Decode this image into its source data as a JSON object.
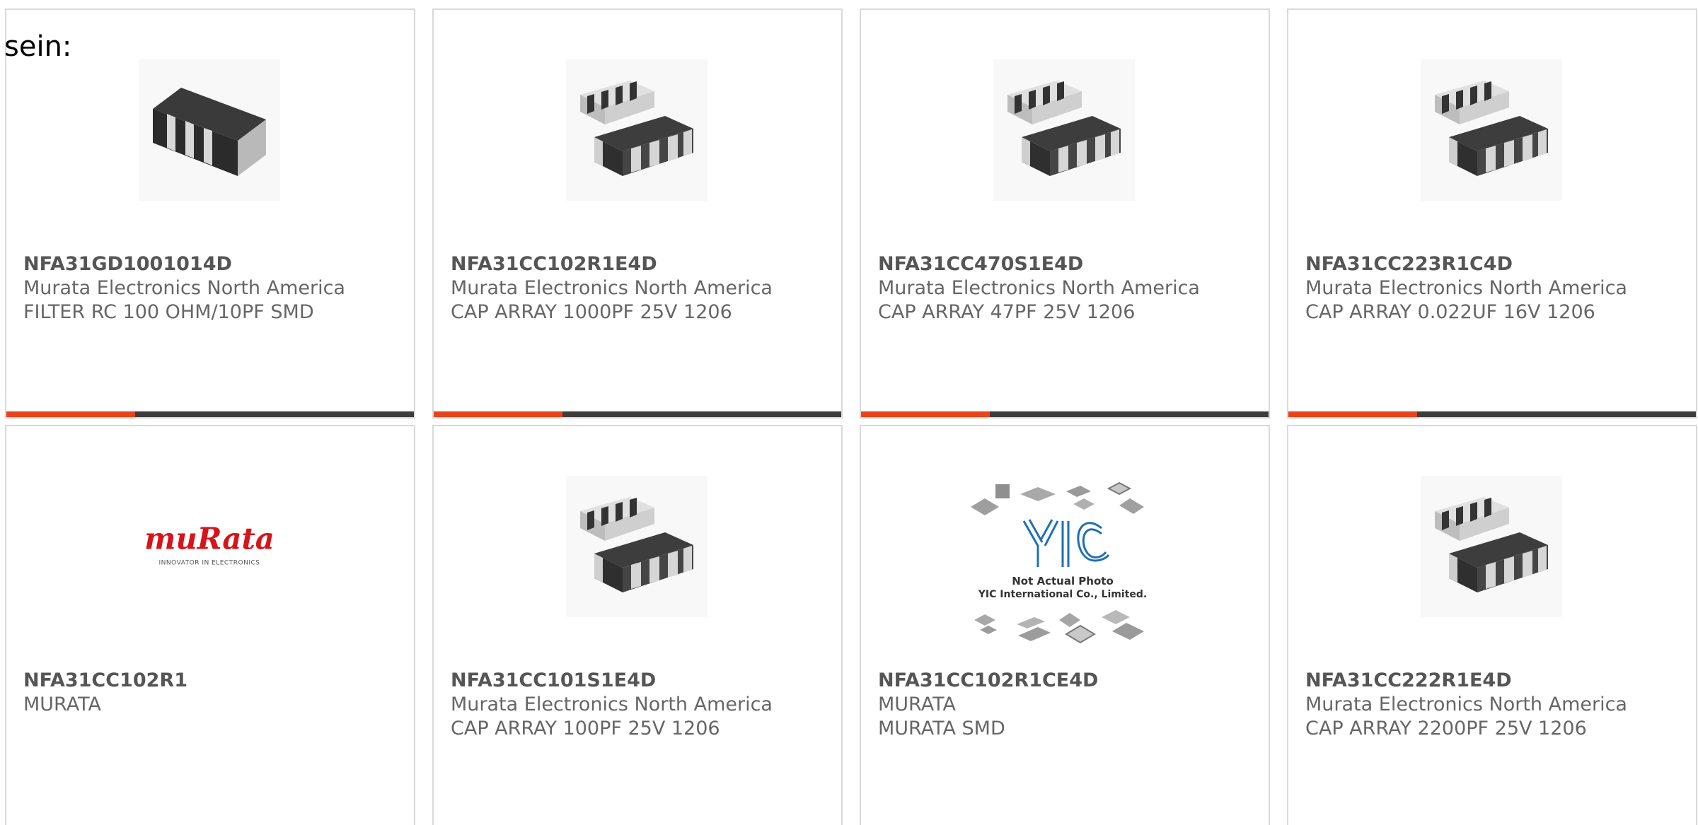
{
  "intro_text": "sein:",
  "colors": {
    "accent": "#e8431a",
    "bar": "#3d3d3d",
    "card_border": "#d9d9d9",
    "text": "#666666",
    "part_number": "#555555"
  },
  "products": [
    {
      "part_number": "NFA31GD1001014D",
      "manufacturer": "Murata Electronics North America",
      "description": "FILTER RC 100 OHM/10PF SMD",
      "image": "single-chip-component-photo"
    },
    {
      "part_number": "NFA31CC102R1E4D",
      "manufacturer": "Murata Electronics North America",
      "description": "CAP ARRAY 1000PF 25V 1206",
      "image": "capacitor-array-photo"
    },
    {
      "part_number": "NFA31CC470S1E4D",
      "manufacturer": "Murata Electronics North America",
      "description": "CAP ARRAY 47PF 25V 1206",
      "image": "capacitor-array-photo"
    },
    {
      "part_number": "NFA31CC223R1C4D",
      "manufacturer": "Murata Electronics North America",
      "description": "CAP ARRAY 0.022UF 16V 1206",
      "image": "capacitor-array-photo"
    },
    {
      "part_number": "NFA31CC102R1",
      "manufacturer": "MURATA",
      "description": "",
      "image": "murata-logo",
      "logo_text": "muRata",
      "logo_tagline": "INNOVATOR IN ELECTRONICS"
    },
    {
      "part_number": "NFA31CC101S1E4D",
      "manufacturer": "Murata Electronics North America",
      "description": "CAP ARRAY 100PF 25V 1206",
      "image": "capacitor-array-photo"
    },
    {
      "part_number": "NFA31CC102R1CE4D",
      "manufacturer": "MURATA",
      "description": "MURATA SMD",
      "image": "yic-placeholder",
      "logo_text": "YIC",
      "caption_line1": "Not Actual Photo",
      "caption_line2": "YIC International Co., Limited."
    },
    {
      "part_number": "NFA31CC222R1E4D",
      "manufacturer": "Murata Electronics North America",
      "description": "CAP ARRAY 2200PF 25V 1206",
      "image": "capacitor-array-photo"
    }
  ]
}
